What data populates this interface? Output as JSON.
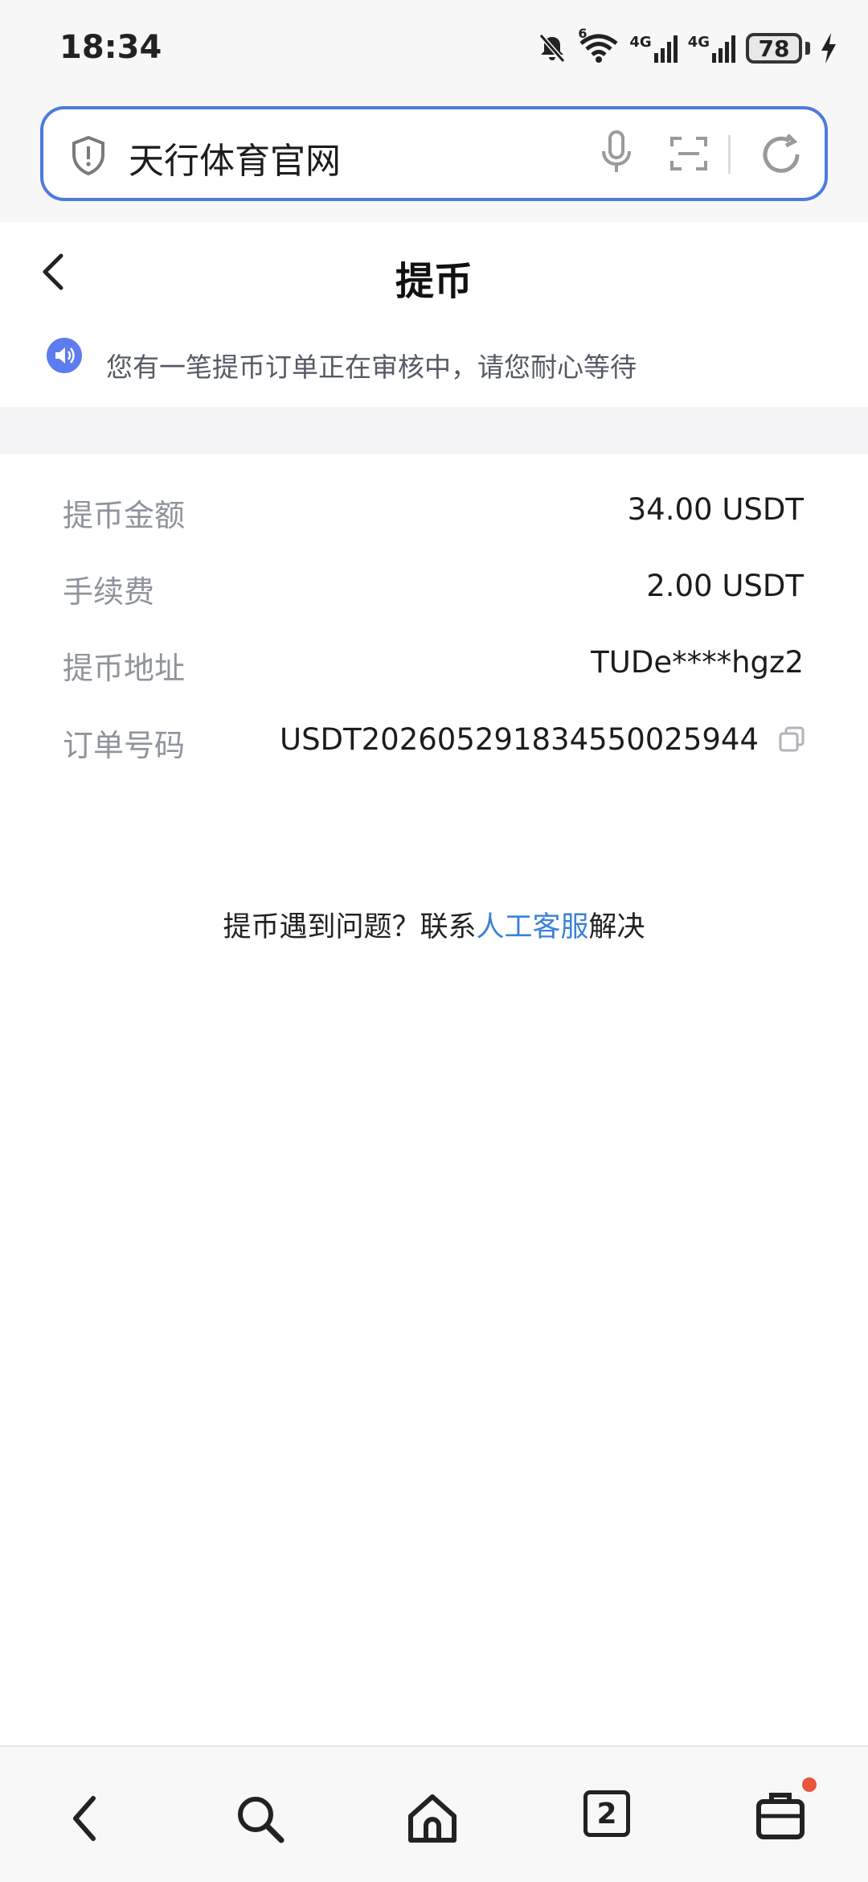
{
  "status": {
    "time": "18:34",
    "battery": "78",
    "network_1": "4G",
    "network_2": "4G",
    "wifi_label": "6"
  },
  "browser": {
    "address_text": "天行体育官网",
    "tabs_count": "2"
  },
  "page": {
    "title": "提币",
    "notice": "您有一笔提币订单正在审核中，请您耐心等待"
  },
  "details": [
    {
      "label": "提币金额",
      "value": "34.00 USDT"
    },
    {
      "label": "手续费",
      "value": "2.00 USDT"
    },
    {
      "label": "提币地址",
      "value": "TUDe****hgz2"
    },
    {
      "label": "订单号码",
      "value": "USDT202605291834550025944"
    }
  ],
  "help": {
    "prefix": "提币遇到问题？联系",
    "link": "人工客服",
    "suffix": "解决"
  },
  "colors": {
    "accent": "#4d7ae0",
    "link": "#3b82d9",
    "notice_icon": "#5d7cf0",
    "badge": "#e8553a"
  },
  "icons": {
    "address_bar": [
      "shield-icon",
      "microphone-icon",
      "scan-icon",
      "refresh-icon"
    ],
    "bottom_nav": [
      "back-icon",
      "search-icon",
      "home-icon",
      "tabs-icon",
      "bag-icon"
    ]
  }
}
